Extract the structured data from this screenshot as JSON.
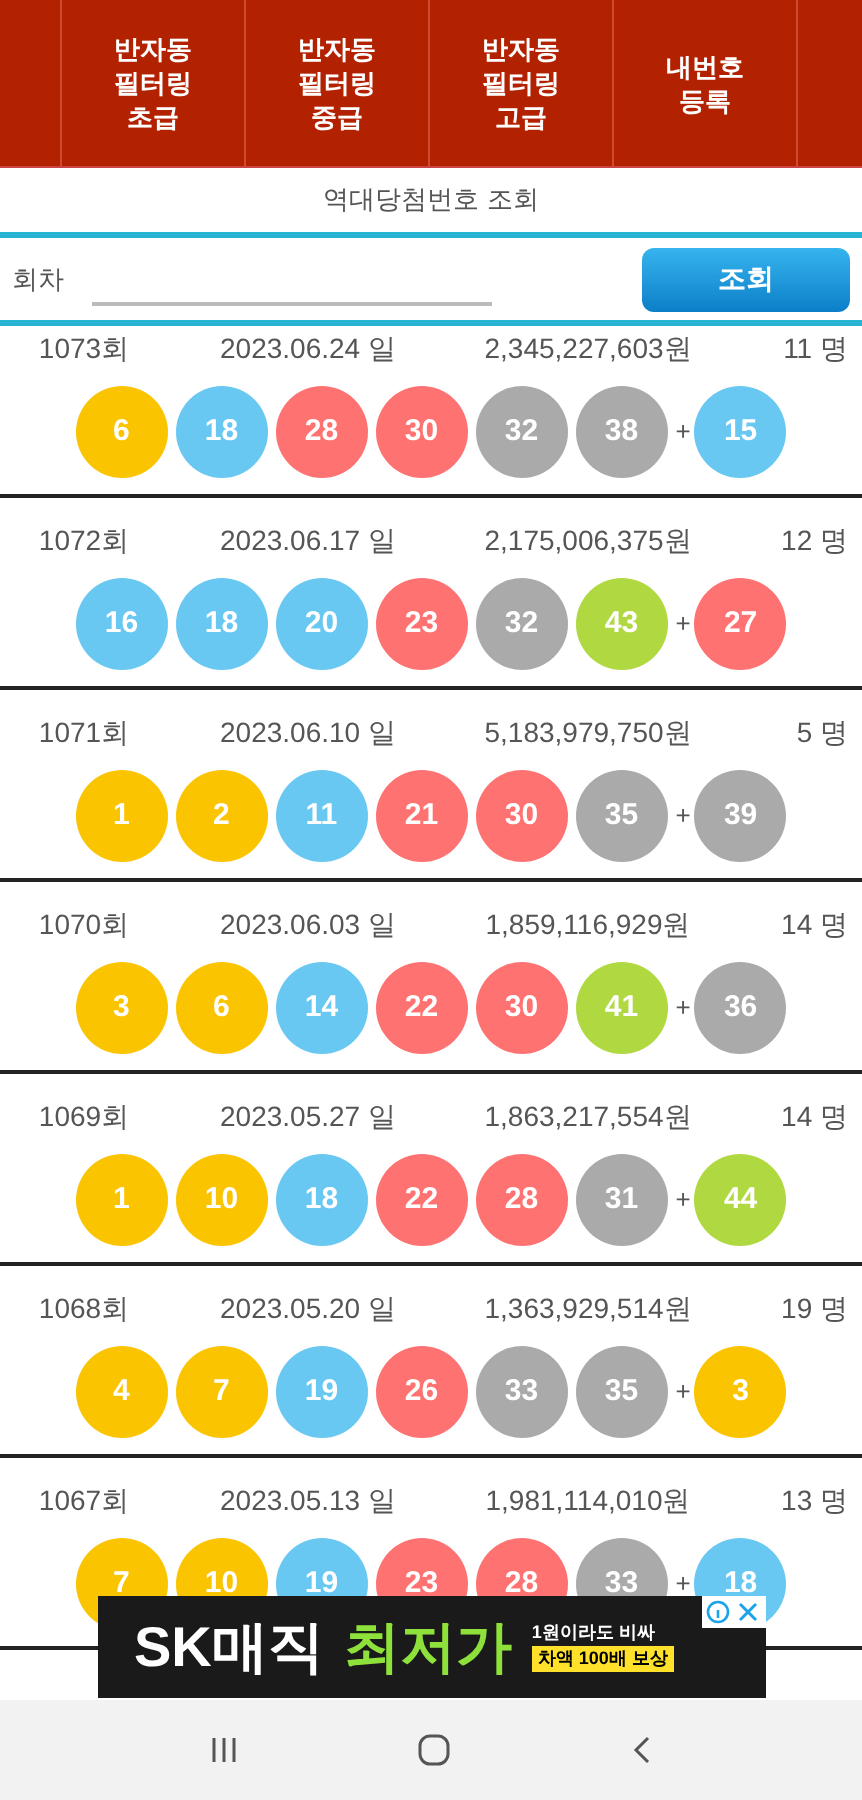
{
  "menu": [
    {
      "label": "반자동\n필터링\n초급"
    },
    {
      "label": "반자동\n필터링\n중급"
    },
    {
      "label": "반자동\n필터링\n고급"
    },
    {
      "label": "내번호\n등록"
    }
  ],
  "title": "역대당첨번호 조회",
  "search": {
    "label": "회차",
    "button": "조회"
  },
  "plus": "+",
  "draws": [
    {
      "round": "1073회",
      "date": "2023.06.24 일",
      "prize": "2,345,227,603원",
      "winners": "11 명",
      "balls": [
        {
          "n": "6",
          "color": "#fbc400"
        },
        {
          "n": "18",
          "color": "#69c8f2"
        },
        {
          "n": "28",
          "color": "#ff7272"
        },
        {
          "n": "30",
          "color": "#ff7272"
        },
        {
          "n": "32",
          "color": "#aaaaaa"
        },
        {
          "n": "38",
          "color": "#aaaaaa"
        },
        {
          "n": "15",
          "color": "#69c8f2"
        }
      ]
    },
    {
      "round": "1072회",
      "date": "2023.06.17 일",
      "prize": "2,175,006,375원",
      "winners": "12 명",
      "balls": [
        {
          "n": "16",
          "color": "#69c8f2"
        },
        {
          "n": "18",
          "color": "#69c8f2"
        },
        {
          "n": "20",
          "color": "#69c8f2"
        },
        {
          "n": "23",
          "color": "#ff7272"
        },
        {
          "n": "32",
          "color": "#aaaaaa"
        },
        {
          "n": "43",
          "color": "#b0d840"
        },
        {
          "n": "27",
          "color": "#ff7272"
        }
      ]
    },
    {
      "round": "1071회",
      "date": "2023.06.10 일",
      "prize": "5,183,979,750원",
      "winners": "5 명",
      "balls": [
        {
          "n": "1",
          "color": "#fbc400"
        },
        {
          "n": "2",
          "color": "#fbc400"
        },
        {
          "n": "11",
          "color": "#69c8f2"
        },
        {
          "n": "21",
          "color": "#ff7272"
        },
        {
          "n": "30",
          "color": "#ff7272"
        },
        {
          "n": "35",
          "color": "#aaaaaa"
        },
        {
          "n": "39",
          "color": "#aaaaaa"
        }
      ]
    },
    {
      "round": "1070회",
      "date": "2023.06.03 일",
      "prize": "1,859,116,929원",
      "winners": "14 명",
      "balls": [
        {
          "n": "3",
          "color": "#fbc400"
        },
        {
          "n": "6",
          "color": "#fbc400"
        },
        {
          "n": "14",
          "color": "#69c8f2"
        },
        {
          "n": "22",
          "color": "#ff7272"
        },
        {
          "n": "30",
          "color": "#ff7272"
        },
        {
          "n": "41",
          "color": "#b0d840"
        },
        {
          "n": "36",
          "color": "#aaaaaa"
        }
      ]
    },
    {
      "round": "1069회",
      "date": "2023.05.27 일",
      "prize": "1,863,217,554원",
      "winners": "14 명",
      "balls": [
        {
          "n": "1",
          "color": "#fbc400"
        },
        {
          "n": "10",
          "color": "#fbc400"
        },
        {
          "n": "18",
          "color": "#69c8f2"
        },
        {
          "n": "22",
          "color": "#ff7272"
        },
        {
          "n": "28",
          "color": "#ff7272"
        },
        {
          "n": "31",
          "color": "#aaaaaa"
        },
        {
          "n": "44",
          "color": "#b0d840"
        }
      ]
    },
    {
      "round": "1068회",
      "date": "2023.05.20 일",
      "prize": "1,363,929,514원",
      "winners": "19 명",
      "balls": [
        {
          "n": "4",
          "color": "#fbc400"
        },
        {
          "n": "7",
          "color": "#fbc400"
        },
        {
          "n": "19",
          "color": "#69c8f2"
        },
        {
          "n": "26",
          "color": "#ff7272"
        },
        {
          "n": "33",
          "color": "#aaaaaa"
        },
        {
          "n": "35",
          "color": "#aaaaaa"
        },
        {
          "n": "3",
          "color": "#fbc400"
        }
      ]
    },
    {
      "round": "1067회",
      "date": "2023.05.13 일",
      "prize": "1,981,114,010원",
      "winners": "13 명",
      "balls": [
        {
          "n": "7",
          "color": "#fbc400"
        },
        {
          "n": "10",
          "color": "#fbc400"
        },
        {
          "n": "19",
          "color": "#69c8f2"
        },
        {
          "n": "23",
          "color": "#ff7272"
        },
        {
          "n": "28",
          "color": "#ff7272"
        },
        {
          "n": "33",
          "color": "#aaaaaa"
        },
        {
          "n": "18",
          "color": "#69c8f2"
        }
      ]
    }
  ],
  "ad": {
    "brand": "SK매직",
    "headline": "최저가",
    "line_1": "1원이라도 비싸",
    "line_2": "차액 100배 보상"
  }
}
